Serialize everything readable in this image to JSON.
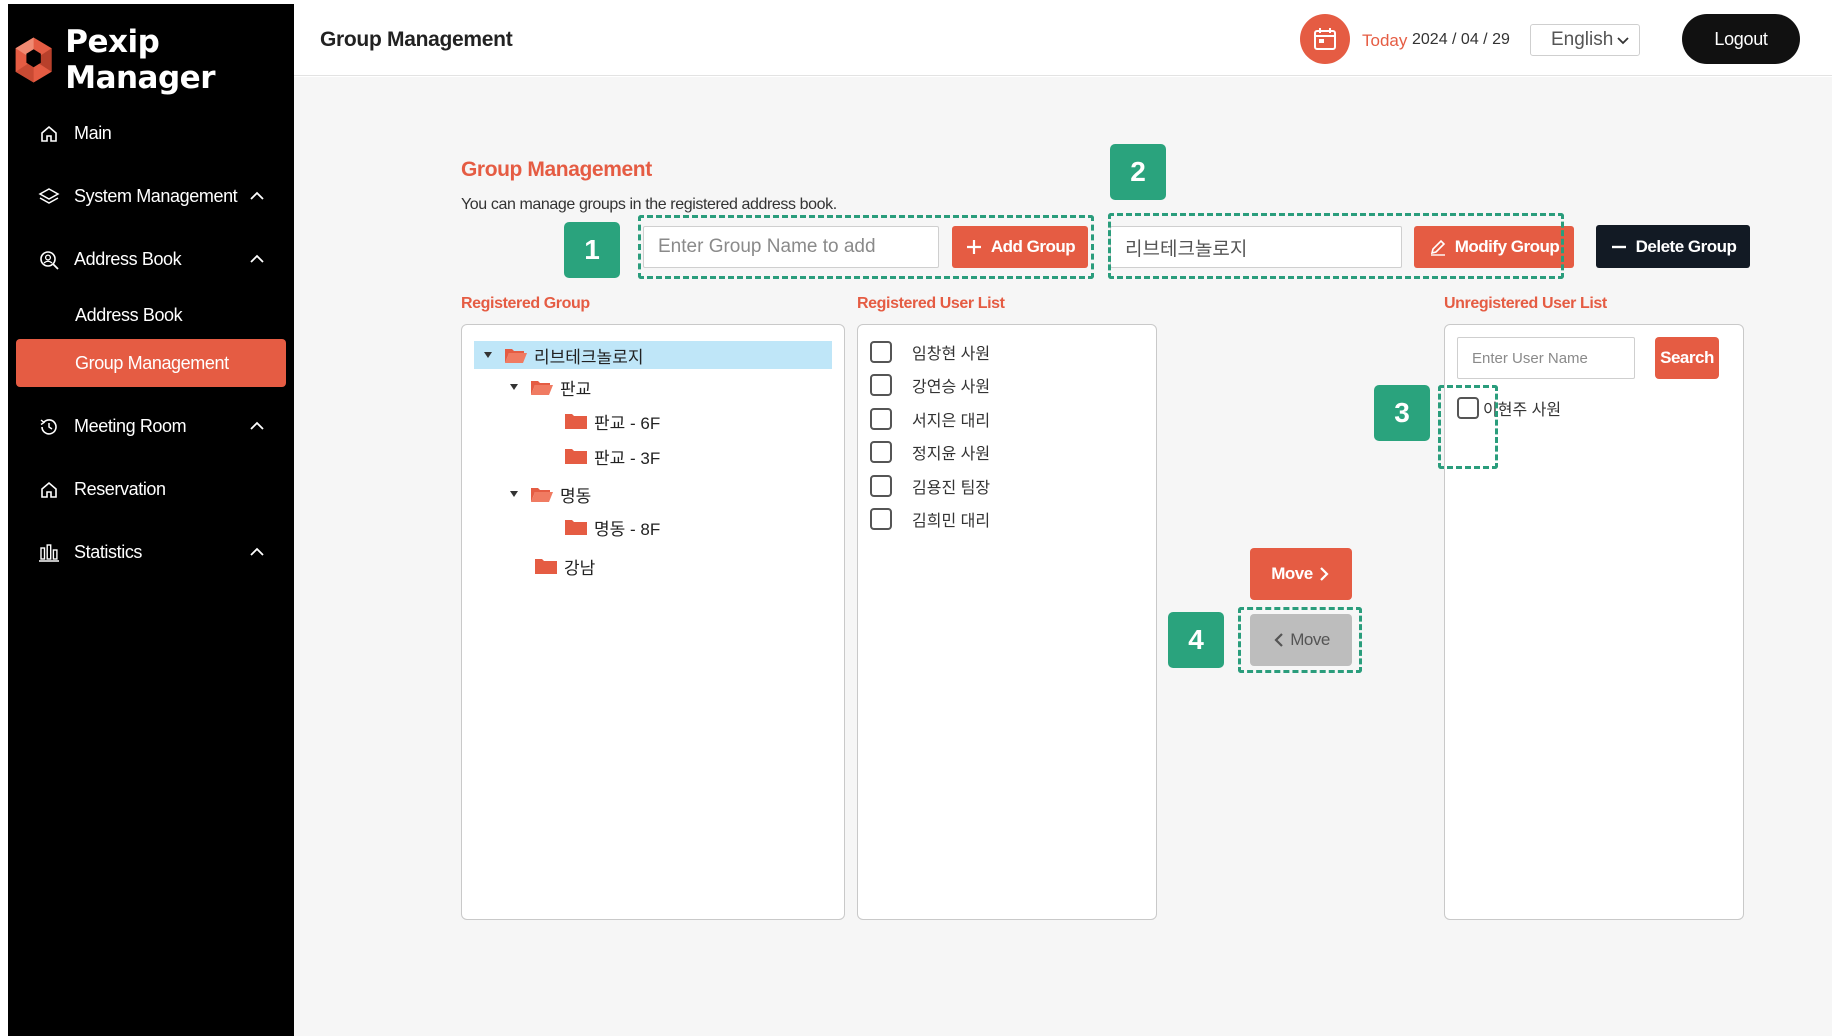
{
  "app": {
    "name": "Pexip Manager"
  },
  "sidebar": {
    "items": [
      {
        "label": "Main",
        "icon": "home-icon"
      },
      {
        "label": "System Management",
        "icon": "layers-icon"
      },
      {
        "label": "Address Book",
        "icon": "search-user-icon"
      },
      {
        "label": "Meeting Room",
        "icon": "history-icon"
      },
      {
        "label": "Reservation",
        "icon": "home-icon"
      },
      {
        "label": "Statistics",
        "icon": "bar-chart-icon"
      }
    ],
    "sub_items": [
      {
        "label": "Address Book"
      },
      {
        "label": "Group Management",
        "active": true
      }
    ]
  },
  "header": {
    "title": "Group Management",
    "today_label": "Today",
    "today_date": "2024 / 04 / 29",
    "language": "English",
    "logout_label": "Logout"
  },
  "main": {
    "title": "Group Management",
    "description": "You can manage groups in the registered address book.",
    "add_group": {
      "placeholder": "Enter Group Name to add",
      "button_label": "Add Group"
    },
    "modify_group": {
      "value": "리브테크놀로지",
      "button_label": "Modify Group"
    },
    "delete_group_label": "Delete Group",
    "registered_group_label": "Registered Group",
    "registered_user_list_label": "Registered User List",
    "unregistered_user_list_label": "Unregistered User List",
    "tree": [
      {
        "label": "리브테크놀로지"
      },
      {
        "label": "판교"
      },
      {
        "label": "판교 - 6F"
      },
      {
        "label": "판교 - 3F"
      },
      {
        "label": "명동"
      },
      {
        "label": "명동 - 8F"
      },
      {
        "label": "강남"
      }
    ],
    "registered_users": [
      "임창현 사원",
      "강연승 사원",
      "서지은 대리",
      "정지윤 사원",
      "김용진 팀장",
      "김희민 대리"
    ],
    "search": {
      "placeholder": "Enter User Name",
      "button_label": "Search"
    },
    "unregistered_users": [
      "이현주 사원"
    ],
    "move_right_label": "Move",
    "move_left_label": "Move"
  },
  "annotations": {
    "badge_1": "1",
    "badge_2": "2",
    "badge_3": "3",
    "badge_4": "4"
  },
  "colors": {
    "accent": "#e55c43",
    "sidebar_bg": "#000000",
    "annotation": "#2aa37d",
    "selection": "#bfe6f8"
  }
}
